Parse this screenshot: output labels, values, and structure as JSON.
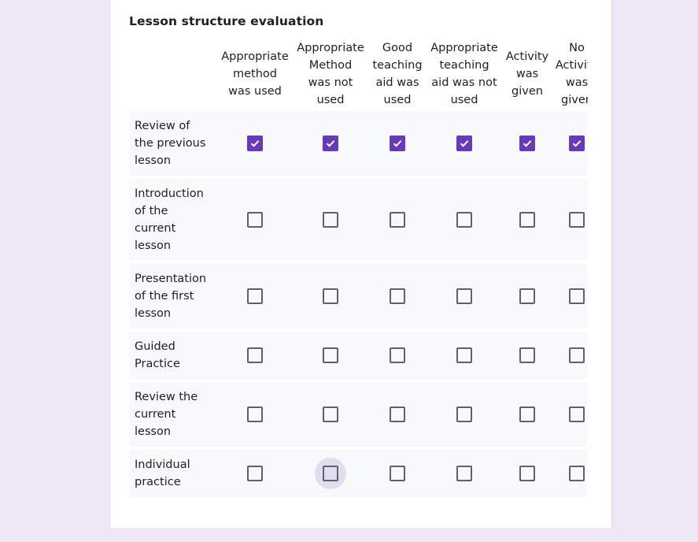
{
  "form": {
    "question_title": "Lesson structure evaluation"
  },
  "grid": {
    "columns": [
      {
        "label": "Appropriate\nmethod\nwas used"
      },
      {
        "label": "Appropriate\nMethod\nwas not\nused"
      },
      {
        "label": "Good\nteaching\naid was\nused"
      },
      {
        "label": "Appropriate\nteaching\naid was not\nused"
      },
      {
        "label": "Activity\nwas\ngiven"
      },
      {
        "label": "No\nActivity\nwas\ngiven"
      }
    ],
    "rows": [
      {
        "label": "Review of\nthe previous\nlesson",
        "checked": [
          true,
          true,
          true,
          true,
          true,
          true
        ]
      },
      {
        "label": "Introduction\nof the\ncurrent\nlesson",
        "checked": [
          false,
          false,
          false,
          false,
          false,
          false
        ]
      },
      {
        "label": "Presentation\nof the first\nlesson",
        "checked": [
          false,
          false,
          false,
          false,
          false,
          false
        ]
      },
      {
        "label": "Guided\nPractice",
        "checked": [
          false,
          false,
          false,
          false,
          false,
          false
        ]
      },
      {
        "label": "Review the\ncurrent\nlesson",
        "checked": [
          false,
          false,
          false,
          false,
          false,
          false
        ]
      },
      {
        "label": "Individual\npractice",
        "checked": [
          false,
          false,
          false,
          false,
          false,
          false
        ]
      }
    ],
    "focused_cell": {
      "row": 5,
      "col": 1
    }
  },
  "colors": {
    "accent": "#673ab7",
    "page_background": "#ede7f6",
    "row_background": "#f8f9fa"
  }
}
